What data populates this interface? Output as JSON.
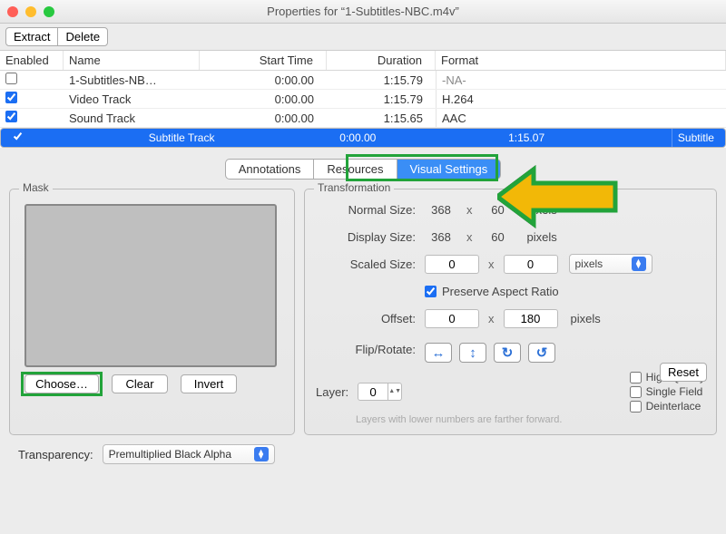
{
  "window": {
    "title": "Properties for “1-Subtitles-NBC.m4v”"
  },
  "toolbar": {
    "extract": "Extract",
    "delete": "Delete"
  },
  "table": {
    "headers": {
      "enabled": "Enabled",
      "name": "Name",
      "start": "Start Time",
      "duration": "Duration",
      "format": "Format"
    },
    "rows": [
      {
        "enabled": false,
        "name": "1-Subtitles-NB…",
        "start": "0:00.00",
        "duration": "1:15.79",
        "format": "-NA-"
      },
      {
        "enabled": true,
        "name": "Video Track",
        "start": "0:00.00",
        "duration": "1:15.79",
        "format": "H.264"
      },
      {
        "enabled": true,
        "name": "Sound Track",
        "start": "0:00.00",
        "duration": "1:15.65",
        "format": "AAC"
      },
      {
        "enabled": true,
        "name": "Subtitle Track",
        "start": "0:00.00",
        "duration": "1:15.07",
        "format": "Subtitle"
      }
    ]
  },
  "tabs": {
    "annotations": "Annotations",
    "resources": "Resources",
    "visual": "Visual Settings"
  },
  "mask": {
    "legend": "Mask",
    "choose": "Choose…",
    "clear": "Clear",
    "invert": "Invert",
    "transparency_label": "Transparency:",
    "transparency_value": "Premultiplied Black Alpha"
  },
  "trans": {
    "legend": "Transformation",
    "normal_label": "Normal Size:",
    "normal_w": "368",
    "normal_h": "60",
    "display_label": "Display Size:",
    "display_w": "368",
    "display_h": "60",
    "scaled_label": "Scaled Size:",
    "scaled_w": "0",
    "scaled_h": "0",
    "unit_value": "pixels",
    "unit_label": "pixels",
    "preserve": "Preserve Aspect Ratio",
    "offset_label": "Offset:",
    "offset_x": "0",
    "offset_y": "180",
    "flip_label": "Flip/Rotate:",
    "reset": "Reset",
    "layer_label": "Layer:",
    "layer_value": "0",
    "hint": "Layers with lower numbers are farther forward.",
    "high_quality": "High Quality",
    "single_field": "Single Field",
    "deinterlace": "Deinterlace",
    "x": "x"
  }
}
